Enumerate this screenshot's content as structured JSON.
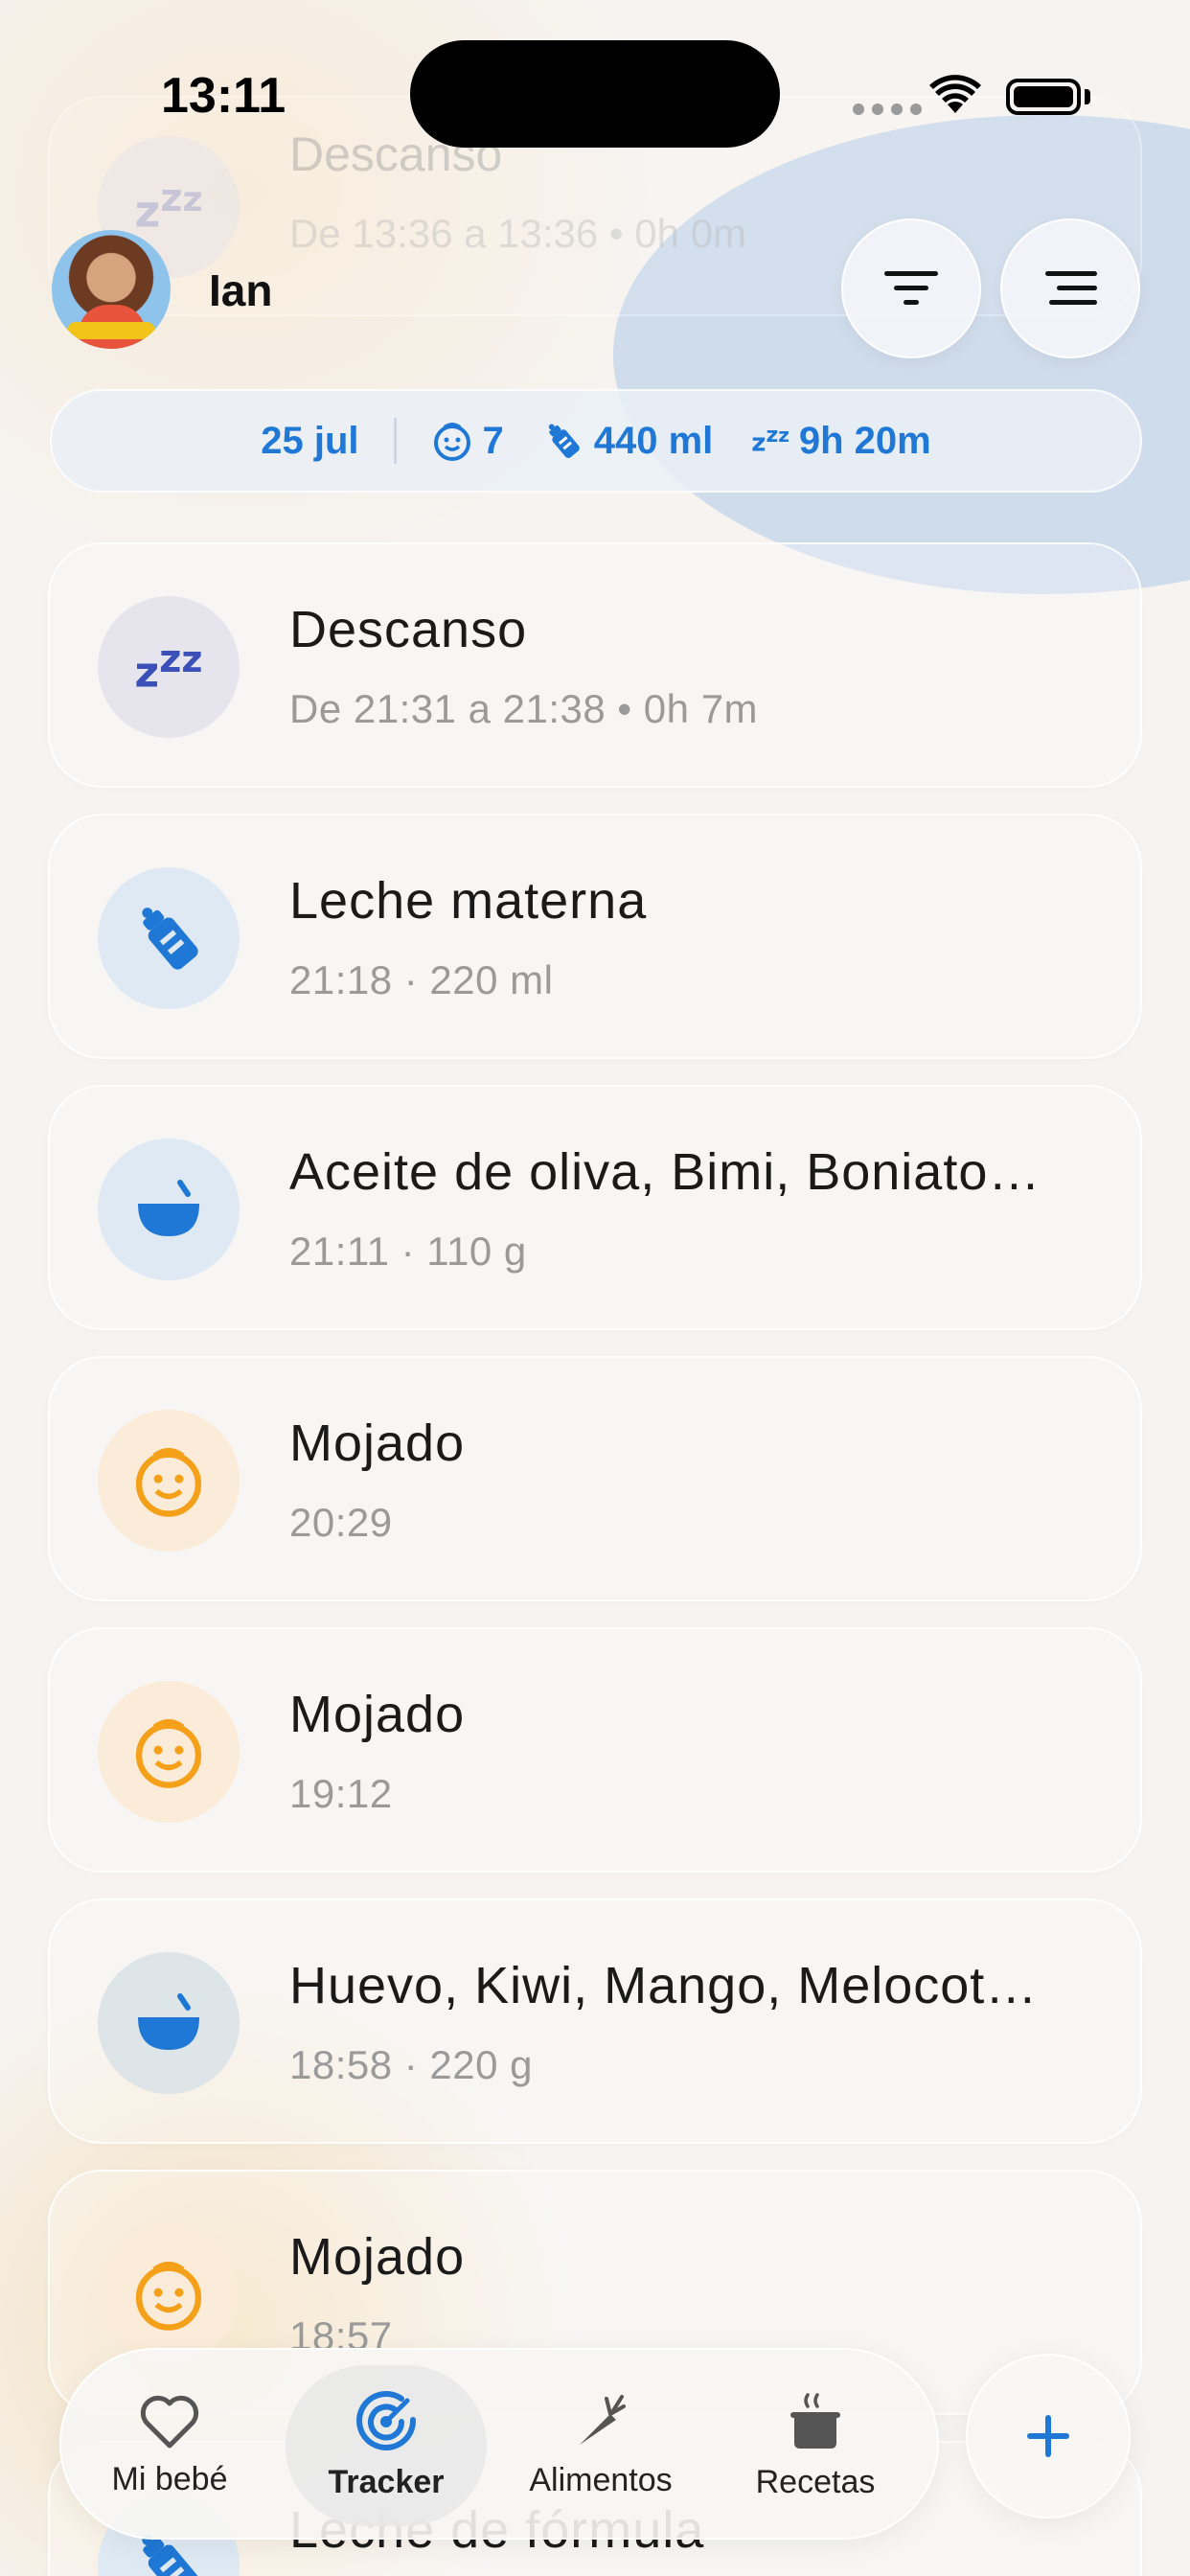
{
  "status_bar": {
    "time": "13:11"
  },
  "header": {
    "user_name": "Ian",
    "ghost_entry": {
      "title": "Descanso",
      "subtitle": "De 13:36 a 13:36 • 0h 0m"
    }
  },
  "summary": {
    "date": "25 jul",
    "diapers": "7",
    "milk": "440 ml",
    "sleep": "9h 20m"
  },
  "entries": [
    {
      "icon": "sleep-icon",
      "title": "Descanso",
      "subtitle": "De 21:31 a 21:38 • 0h 7m"
    },
    {
      "icon": "bottle-icon",
      "title": "Leche materna",
      "subtitle": "21:18 · 220 ml"
    },
    {
      "icon": "bowl-icon",
      "title": "Aceite de oliva, Bimi, Boniato…",
      "subtitle": "21:11 · 110 g"
    },
    {
      "icon": "diaper-face-icon",
      "title": "Mojado",
      "subtitle": "20:29"
    },
    {
      "icon": "diaper-face-icon",
      "title": "Mojado",
      "subtitle": "19:12"
    },
    {
      "icon": "bowl-icon",
      "title": "Huevo, Kiwi, Mango, Melocot…",
      "subtitle": "18:58 · 220 g"
    },
    {
      "icon": "diaper-face-icon",
      "title": "Mojado",
      "subtitle": "18:57"
    },
    {
      "icon": "bottle-icon",
      "title": "Leche de fórmula",
      "subtitle": ""
    }
  ],
  "tabs": [
    {
      "label": "Mi bebé",
      "icon": "heart-icon"
    },
    {
      "label": "Tracker",
      "icon": "target-icon",
      "active": true
    },
    {
      "label": "Alimentos",
      "icon": "carrot-icon"
    },
    {
      "label": "Recetas",
      "icon": "pot-icon"
    }
  ],
  "colors": {
    "accent": "#1f78d6",
    "orange": "#f5a019",
    "sleep": "#3b4fb8"
  }
}
